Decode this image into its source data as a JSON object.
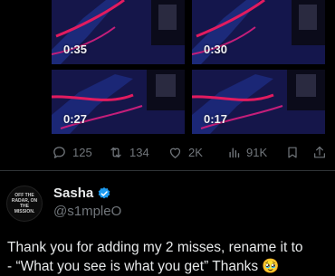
{
  "videos": [
    {
      "duration": "0:35"
    },
    {
      "duration": "0:30"
    },
    {
      "duration": "0:27"
    },
    {
      "duration": "0:17"
    }
  ],
  "tweet_actions": {
    "replies": "125",
    "reposts": "134",
    "likes": "2K",
    "views": "91K"
  },
  "reply": {
    "avatar_text": "OFF THE RADAR, ON THE MISSION.",
    "name": "Sasha",
    "handle": "@s1mpleO",
    "text_line1": "Thank you for adding my 2 misses, rename it to",
    "text_line2": "- “What you see is what you get” Thanks 🥹"
  },
  "colors": {
    "background": "#000000",
    "text": "#e7e9ea",
    "muted": "#71767b",
    "verified": "#1d9bf0",
    "tile_accent": "#e21b5f"
  }
}
